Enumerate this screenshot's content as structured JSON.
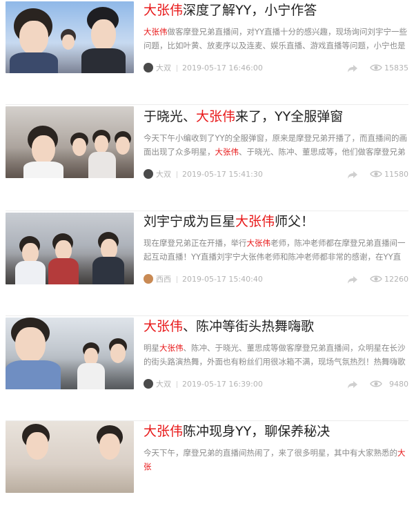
{
  "colors": {
    "highlight": "#e8191a",
    "meta": "#b3b3b3",
    "summary": "#8a8a8a",
    "title": "#222222"
  },
  "articles": [
    {
      "title_hl": "大张伟",
      "title_rest": "深度了解YY，小宁作答",
      "summary_hl": "大张伟",
      "summary_rest": "做客摩登兄弟直播间，对YY直播十分的感兴趣，现场询问刘宇宁一些问题，比如叶黄、放麦序以及连麦、娱乐直播、游戏直播等问题，小宁也是一一作答。听到小宁的讲解之后大张伟似乎已经十分的了解了，貌似非",
      "author": "大双",
      "date": "2019-05-17 16:46:00",
      "views": "15835",
      "avatar_color": "#4a4a4a"
    },
    {
      "title_pre": "于晓光、",
      "title_hl": "大张伟",
      "title_rest": "来了，YY全服弹窗",
      "summary_pre": "今天下午小编收到了YY的全服弹窗，原来是摩登兄弟开播了，而直播间的画面出现了众多明星，",
      "summary_hl": "大张伟",
      "summary_rest": "、于晓光、陈冲、董思成等，他们做客摩登兄弟的直播间，与粉丝们交流。刘宇宁还教大明星喊起了口号“往后余生",
      "author": "大双",
      "date": "2019-05-17 15:41:30",
      "views": "11580",
      "avatar_color": "#4a4a4a"
    },
    {
      "title_pre": "刘宇宁成为巨星",
      "title_hl": "大张伟",
      "title_rest": "师父！",
      "summary_pre": "现在摩登兄弟正在开播，举行",
      "summary_hl": "大张伟",
      "summary_rest": "老师，陈冲老师都在摩登兄弟直播间一起互动直播！YY直播刘宇宁大张伟老师和陈冲老师都非常的感谢，在YY直播上他们都是新手！直播中大张伟老师，陈冲老师称呼刘宇宁老师：大张伟",
      "author": "西西",
      "date": "2019-05-17 15:40:40",
      "views": "12260",
      "avatar_color": "#c98a54"
    },
    {
      "title_hl": "大张伟",
      "title_rest": "、陈冲等街头热舞嗨歌",
      "summary_pre": "明星",
      "summary_hl": "大张伟",
      "summary_rest": "、陈冲、于晓光、董思成等做客摩登兄弟直播间，众明星在长沙的街头路演热舞，外面也有粉丝们用很冰箱不满，现场气氛热烈！热舞嗨歌对大张伟以及陈冲老师来说可谓是手到擒来，他们的娱乐也通过YY现场",
      "author": "大双",
      "date": "2019-05-17 16:39:00",
      "views": "9480",
      "avatar_color": "#4a4a4a"
    },
    {
      "title_hl": "大张伟",
      "title_rest": "陈冲现身YY，聊保养秘决",
      "summary_pre": "今天下午，摩登兄弟的直播间热闹了，来了很多明星，其中有大家熟悉的",
      "summary_hl": "大张",
      "summary_rest": "",
      "author": "",
      "date": "",
      "views": "",
      "avatar_color": "#4a4a4a"
    }
  ],
  "icons": {
    "share": "share-icon",
    "views": "eye-icon"
  }
}
